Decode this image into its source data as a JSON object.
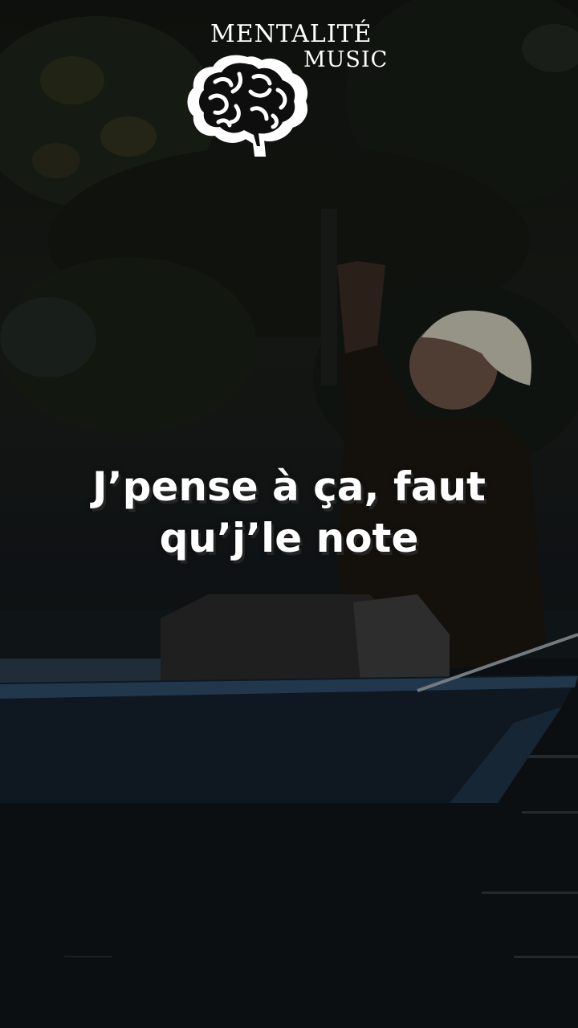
{
  "logo": {
    "line1": "MENTALITÉ",
    "line2": "MUSIC",
    "icon": "brain-icon"
  },
  "caption": {
    "line1": "J’pense à ça, faut",
    "line2": "qu’j’le note"
  },
  "colors": {
    "text": "#ffffff",
    "background": "#0b0d0f",
    "boat": "#1c2a3a"
  }
}
